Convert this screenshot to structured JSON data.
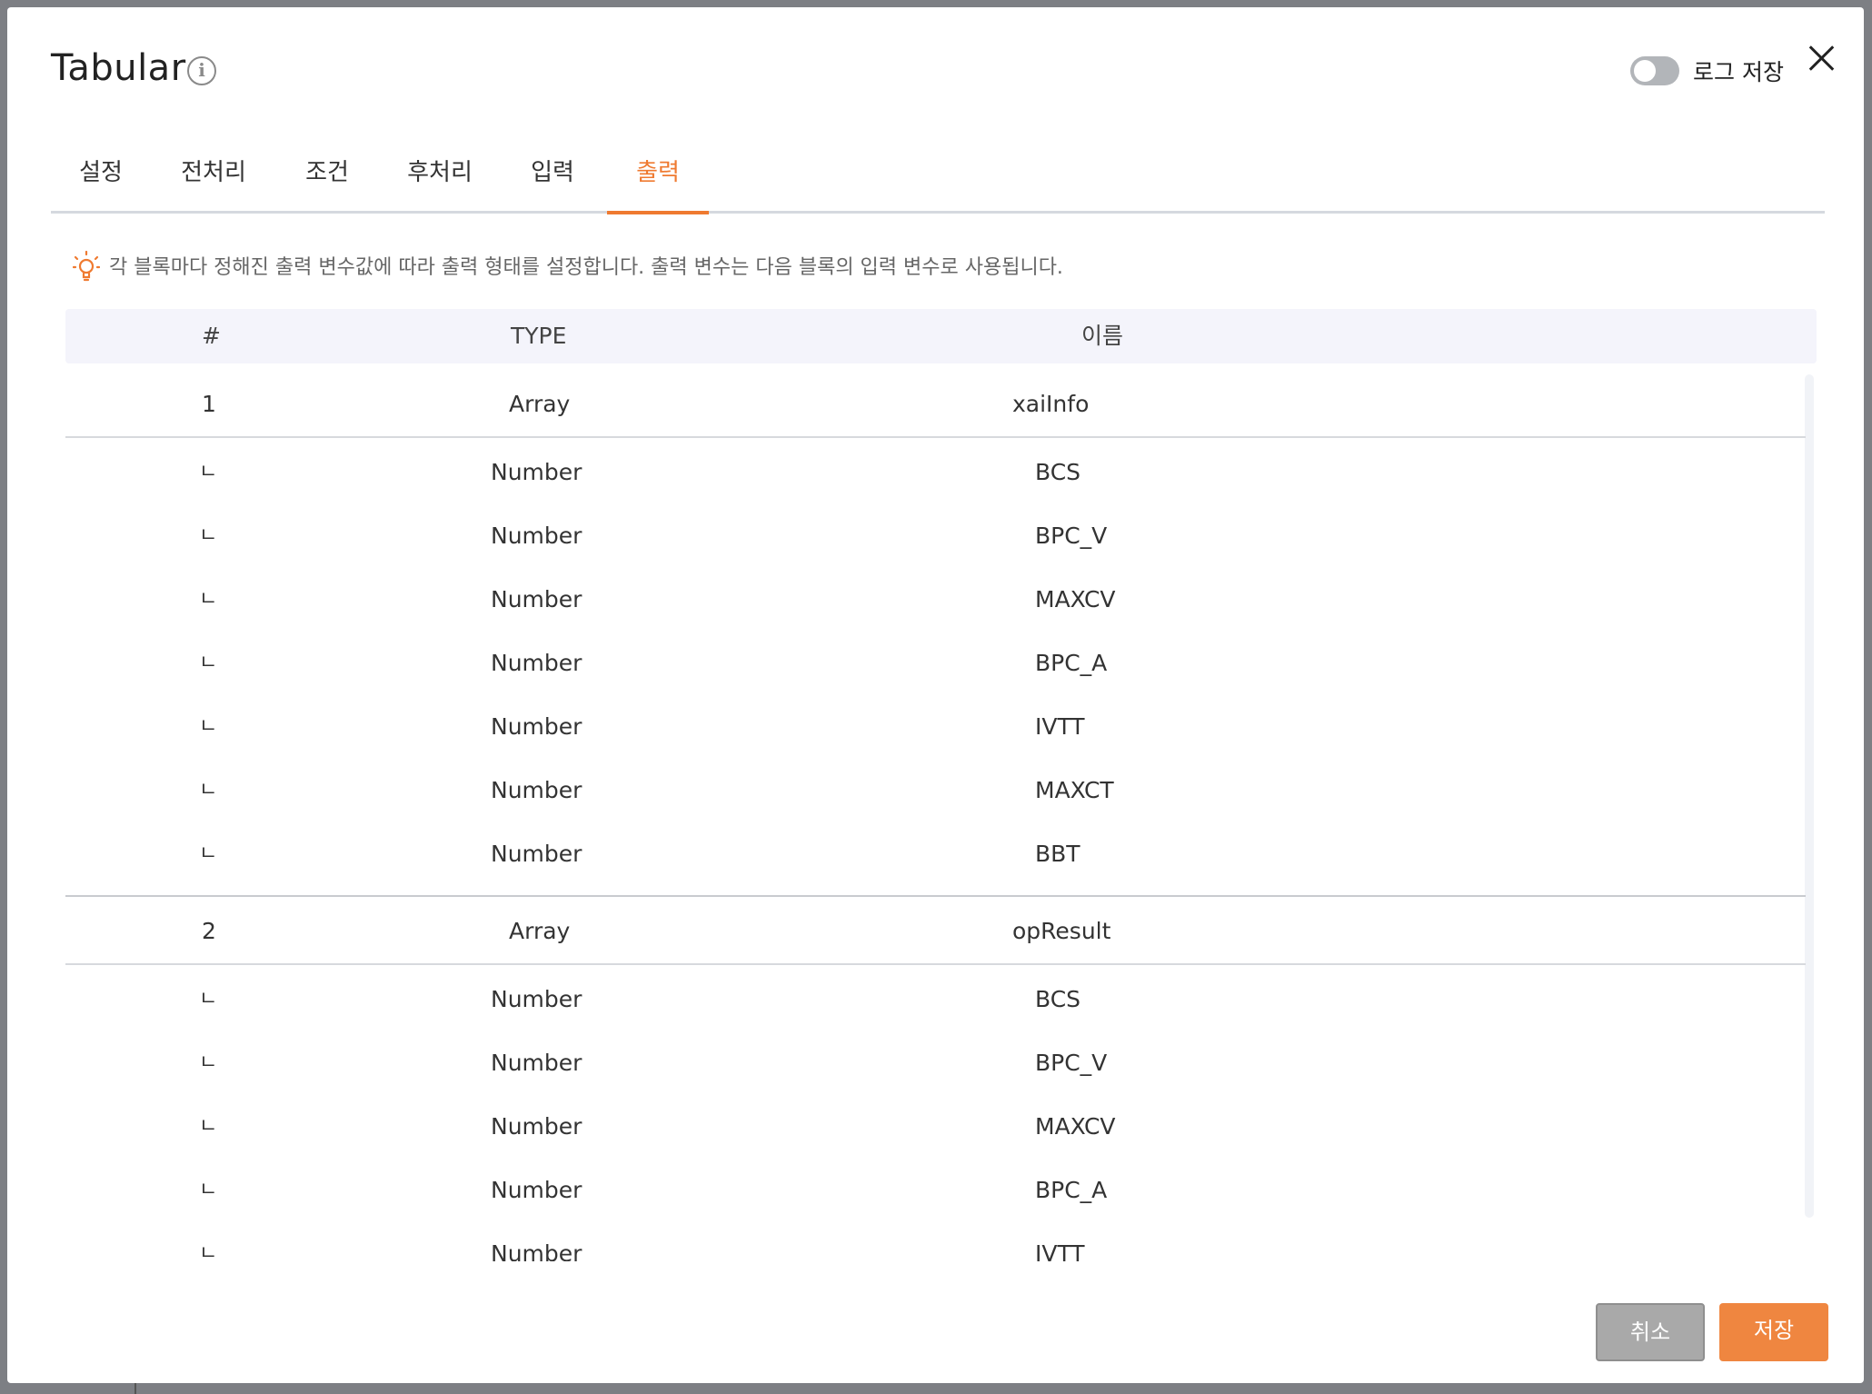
{
  "dialog": {
    "title": "Tabular",
    "log_toggle_label": "로그 저장",
    "log_toggle_on": false
  },
  "tabs": [
    {
      "label": "설정",
      "active": false
    },
    {
      "label": "전처리",
      "active": false
    },
    {
      "label": "조건",
      "active": false
    },
    {
      "label": "후처리",
      "active": false
    },
    {
      "label": "입력",
      "active": false
    },
    {
      "label": "출력",
      "active": true
    }
  ],
  "hint": {
    "icon": "lightbulb-icon",
    "text": "각 블록마다 정해진 출력 변수값에 따라 출력 형태를 설정합니다. 출력 변수는 다음 블록의 입력 변수로 사용됩니다."
  },
  "table": {
    "columns": [
      "#",
      "TYPE",
      "이름"
    ],
    "rows": [
      {
        "index": "1",
        "type": "Array",
        "name": "xaiInfo",
        "children": [
          {
            "marker": "ㄴ",
            "type": "Number",
            "name": "BCS"
          },
          {
            "marker": "ㄴ",
            "type": "Number",
            "name": "BPC_V"
          },
          {
            "marker": "ㄴ",
            "type": "Number",
            "name": "MAXCV"
          },
          {
            "marker": "ㄴ",
            "type": "Number",
            "name": "BPC_A"
          },
          {
            "marker": "ㄴ",
            "type": "Number",
            "name": "IVTT"
          },
          {
            "marker": "ㄴ",
            "type": "Number",
            "name": "MAXCT"
          },
          {
            "marker": "ㄴ",
            "type": "Number",
            "name": "BBT"
          }
        ]
      },
      {
        "index": "2",
        "type": "Array",
        "name": "opResult",
        "children": [
          {
            "marker": "ㄴ",
            "type": "Number",
            "name": "BCS"
          },
          {
            "marker": "ㄴ",
            "type": "Number",
            "name": "BPC_V"
          },
          {
            "marker": "ㄴ",
            "type": "Number",
            "name": "MAXCV"
          },
          {
            "marker": "ㄴ",
            "type": "Number",
            "name": "BPC_A"
          },
          {
            "marker": "ㄴ",
            "type": "Number",
            "name": "IVTT"
          }
        ]
      }
    ]
  },
  "buttons": {
    "cancel": "취소",
    "save": "저장"
  },
  "colors": {
    "accent": "#ef7a30",
    "save_button": "#ef8640",
    "cancel_button": "#a9a9a9",
    "header_bg": "#f4f4fb"
  }
}
